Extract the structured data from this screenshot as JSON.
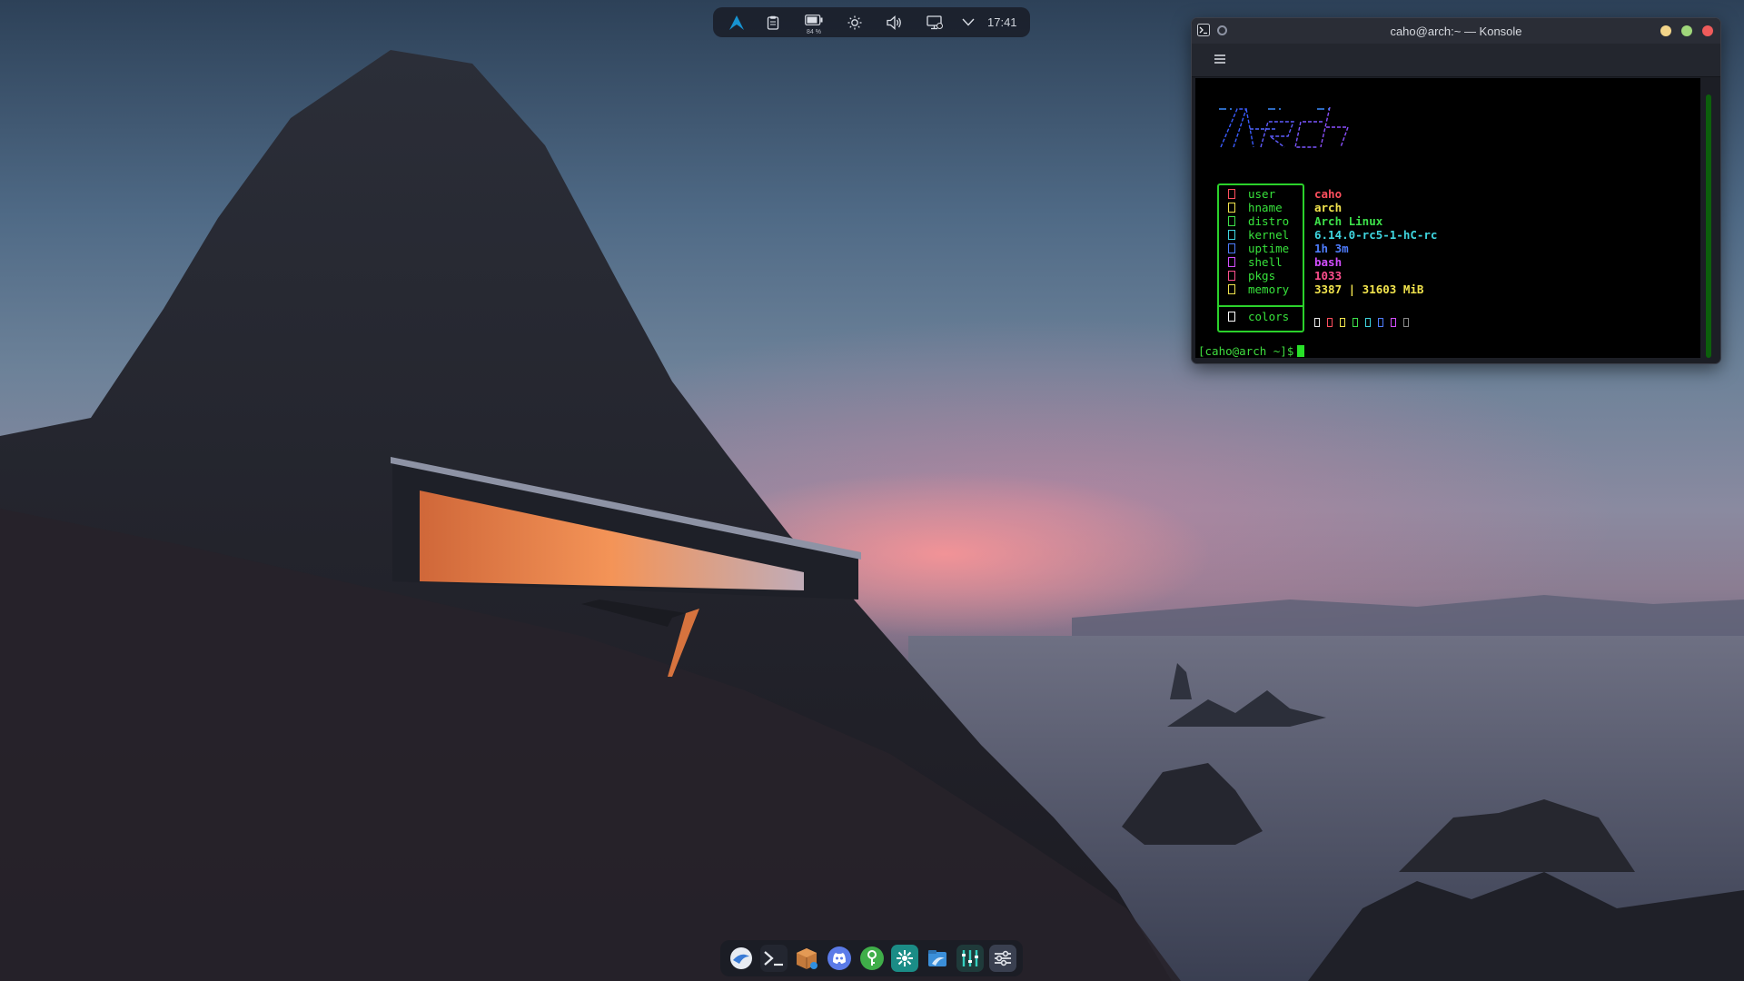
{
  "panel": {
    "clock": "17:41",
    "battery_percent": "84 %",
    "icons": [
      "arch-launcher-icon",
      "clipboard-icon",
      "battery-icon",
      "brightness-icon",
      "volume-icon",
      "display-icon",
      "chevron-down-icon"
    ]
  },
  "window": {
    "title": "caho@arch:~ — Konsole",
    "buttons": [
      "minimize",
      "maximize",
      "close"
    ]
  },
  "fetch": {
    "rows": [
      {
        "label": "user",
        "value": "caho",
        "color": "#ff4f5e"
      },
      {
        "label": "hname",
        "value": "arch",
        "color": "#f2e44d"
      },
      {
        "label": "distro",
        "value": "Arch Linux",
        "color": "#3de04a"
      },
      {
        "label": "kernel",
        "value": "6.14.0-rc5-1-hC-rc",
        "color": "#3fd6e0"
      },
      {
        "label": "uptime",
        "value": "1h 3m",
        "color": "#4f7dff"
      },
      {
        "label": "shell",
        "value": "bash",
        "color": "#d24dff"
      },
      {
        "label": "pkgs",
        "value": "1033",
        "color": "#ff4f8e"
      },
      {
        "label": "memory",
        "value": "3387 | 31603 MiB",
        "color": "#f2e44d"
      }
    ],
    "colors_label": "colors",
    "palette": [
      "#e8e8e8",
      "#ff4f5e",
      "#f2e44d",
      "#3de04a",
      "#3fd6e0",
      "#4f7dff",
      "#d24dff",
      "#8a8a8a"
    ]
  },
  "terminal": {
    "prompt": "[caho@arch ~]$"
  },
  "dock": {
    "apps": [
      "discover-icon",
      "konsole-icon",
      "package-icon",
      "discord-icon",
      "keepass-icon",
      "kde-connect-icon",
      "dolphin-icon",
      "system-monitor-icon",
      "settings-icon"
    ]
  },
  "colors": {
    "accent": "#1793d1",
    "terminal_green": "#2bd12b"
  }
}
